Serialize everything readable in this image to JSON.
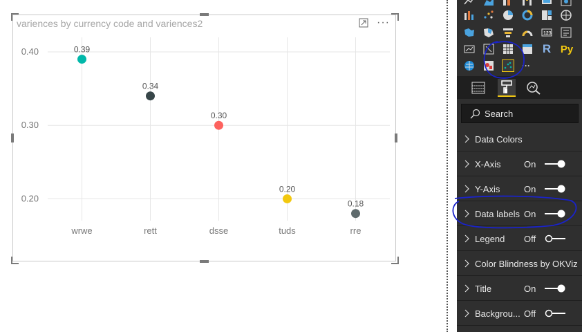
{
  "visual": {
    "title": "variences by currency code and variences2"
  },
  "chart_data": {
    "type": "scatter",
    "title": "variences by currency code and variences2",
    "categories": [
      "wrwe",
      "rett",
      "dsse",
      "tuds",
      "rre"
    ],
    "values": [
      0.39,
      0.34,
      0.3,
      0.2,
      0.18
    ],
    "data_labels": [
      "0.39",
      "0.34",
      "0.30",
      "0.20",
      "0.18"
    ],
    "point_colors": [
      "#01b8aa",
      "#374649",
      "#fd625e",
      "#f2c80f",
      "#5f6b6d"
    ],
    "yticks": [
      "0.40",
      "0.30",
      "0.20"
    ],
    "ytick_values": [
      0.4,
      0.3,
      0.2
    ],
    "ylim": [
      0.175,
      0.415
    ],
    "grid": true,
    "legend": "none"
  },
  "pane": {
    "search_placeholder": "Search",
    "rows": [
      {
        "label": "Data Colors"
      },
      {
        "label": "X-Axis",
        "state": "On",
        "on": true
      },
      {
        "label": "Y-Axis",
        "state": "On",
        "on": true
      },
      {
        "label": "Data labels",
        "state": "On",
        "on": true
      },
      {
        "label": "Legend",
        "state": "Off",
        "on": false
      },
      {
        "label": "Color Blindness by OKViz"
      },
      {
        "label": "Title",
        "state": "On",
        "on": true
      },
      {
        "label": "Backgrou...",
        "state": "Off",
        "on": false
      }
    ],
    "viz_letters": {
      "r": "R",
      "py": "Py",
      "more": "···"
    }
  },
  "colors": {
    "pane_bg": "#2f2f2f",
    "annotation": "#1a23c9",
    "accent": "#f2c811"
  }
}
